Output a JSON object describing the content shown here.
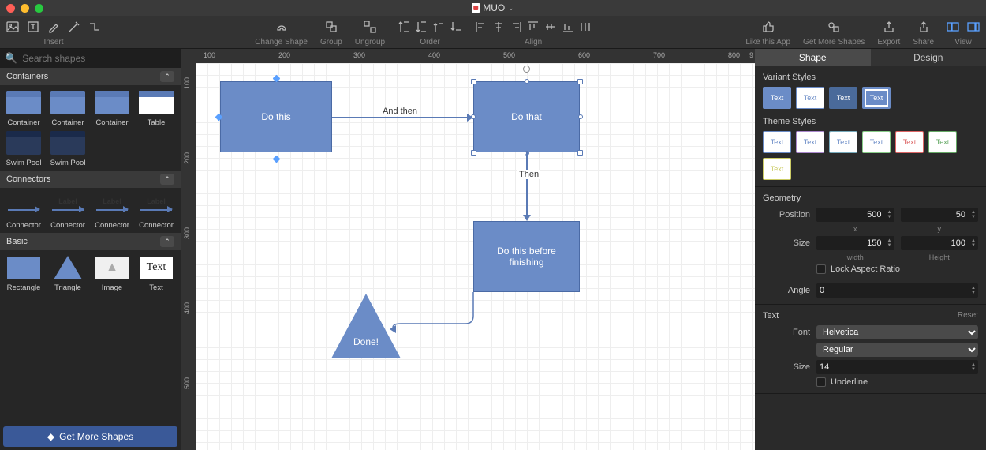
{
  "title": "MUO",
  "toolbar": {
    "insert": "Insert",
    "changeShape": "Change Shape",
    "group": "Group",
    "ungroup": "Ungroup",
    "order": "Order",
    "align": "Align",
    "likeApp": "Like this App",
    "moreShapes": "Get More Shapes",
    "export": "Export",
    "share": "Share",
    "view": "View"
  },
  "search": {
    "placeholder": "Search shapes"
  },
  "left": {
    "containers": "Containers",
    "connectors": "Connectors",
    "basic": "Basic",
    "containerItems": [
      {
        "label": "Container"
      },
      {
        "label": "Container"
      },
      {
        "label": "Container"
      },
      {
        "label": "Table"
      },
      {
        "label": "Swim Pool"
      },
      {
        "label": "Swim Pool"
      }
    ],
    "connectorItems": [
      {
        "label": "Connector",
        "tag": ""
      },
      {
        "label": "Connector",
        "tag": "Label"
      },
      {
        "label": "Connector",
        "tag": "Label"
      },
      {
        "label": "Connector",
        "tag": "Label"
      }
    ],
    "basicItems": [
      {
        "label": "Rectangle"
      },
      {
        "label": "Triangle"
      },
      {
        "label": "Image"
      },
      {
        "label": "Text"
      }
    ],
    "moreShapes": "Get More Shapes"
  },
  "canvas": {
    "hticks": [
      "100",
      "200",
      "300",
      "400",
      "500",
      "600",
      "700",
      "800",
      "9"
    ],
    "vticks": [
      "100",
      "200",
      "300",
      "400",
      "500"
    ],
    "shape1": "Do this",
    "shape2": "Do that",
    "shape3": "Do this before finishing",
    "shape4": "Done!",
    "edge1": "And then",
    "edge2": "Then"
  },
  "right": {
    "shapeTab": "Shape",
    "designTab": "Design",
    "variant": "Variant Styles",
    "theme": "Theme Styles",
    "vtext": "Text",
    "geometry": "Geometry",
    "position": "Position",
    "posX": "500",
    "posY": "50",
    "xLbl": "x",
    "yLbl": "y",
    "size": "Size",
    "w": "150",
    "h": "100",
    "wLbl": "width",
    "hLbl": "Height",
    "lockAR": "Lock Aspect Ratio",
    "angle": "Angle",
    "angleVal": "0",
    "text": "Text",
    "reset": "Reset",
    "font": "Font",
    "fontVal": "Helvetica",
    "weightVal": "Regular",
    "fontSize": "Size",
    "fontSizeVal": "14",
    "underline": "Underline"
  }
}
